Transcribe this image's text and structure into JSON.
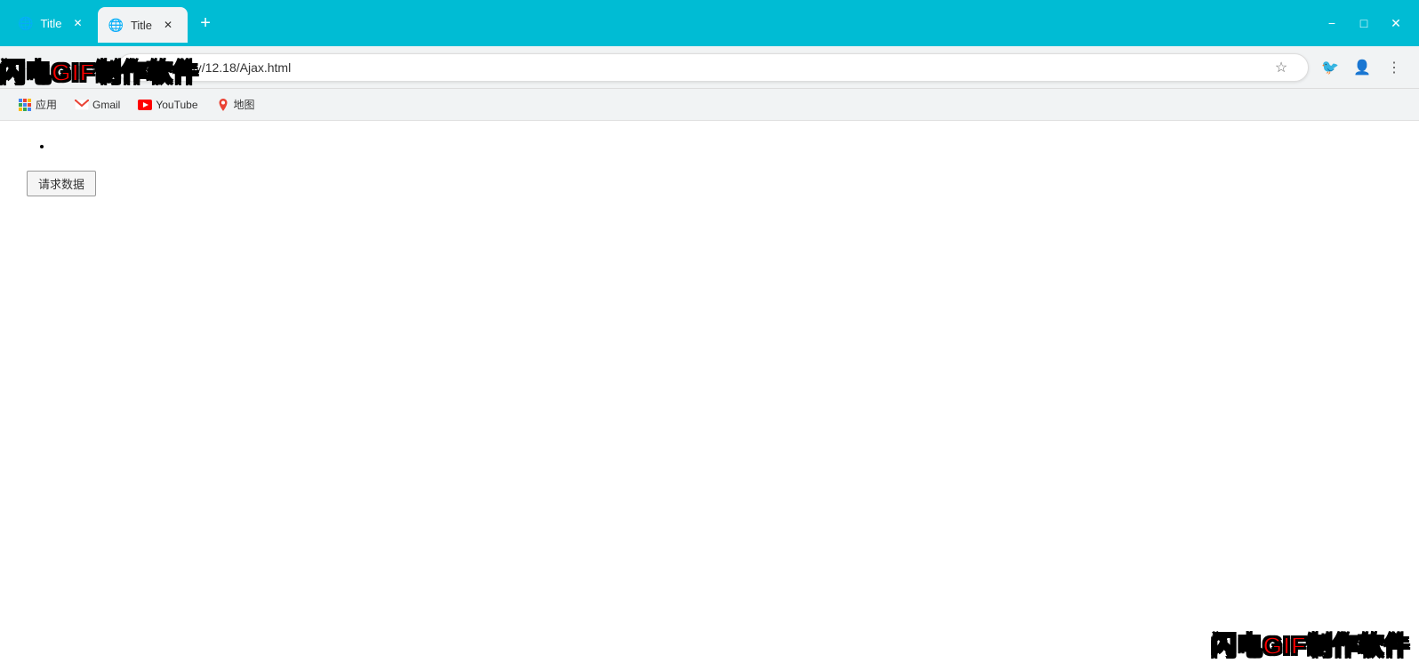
{
  "titlebar": {
    "tab1": {
      "label": "Title",
      "active": false
    },
    "tab2": {
      "label": "Title",
      "active": true
    },
    "new_tab_label": "+",
    "window_controls": {
      "minimize": "−",
      "maximize": "□",
      "close": "✕"
    }
  },
  "addressbar": {
    "back_icon": "←",
    "forward_icon": "→",
    "refresh_icon": "↻",
    "url": "localhost/my/12.18/Ajax.html",
    "star_icon": "☆",
    "bird_icon": "🐦",
    "profile_icon": "👤",
    "menu_icon": "⋮"
  },
  "bookmarks": [
    {
      "label": "应用",
      "icon": "grid"
    },
    {
      "label": "Gmail",
      "icon": "gmail"
    },
    {
      "label": "YouTube",
      "icon": "youtube"
    },
    {
      "label": "地图",
      "icon": "maps"
    }
  ],
  "page": {
    "bullet_item": "",
    "request_button_label": "请求数据"
  },
  "watermark": {
    "top_left": "闪电GIF制作软件",
    "bottom_right": "闪电GIF制作软件"
  }
}
